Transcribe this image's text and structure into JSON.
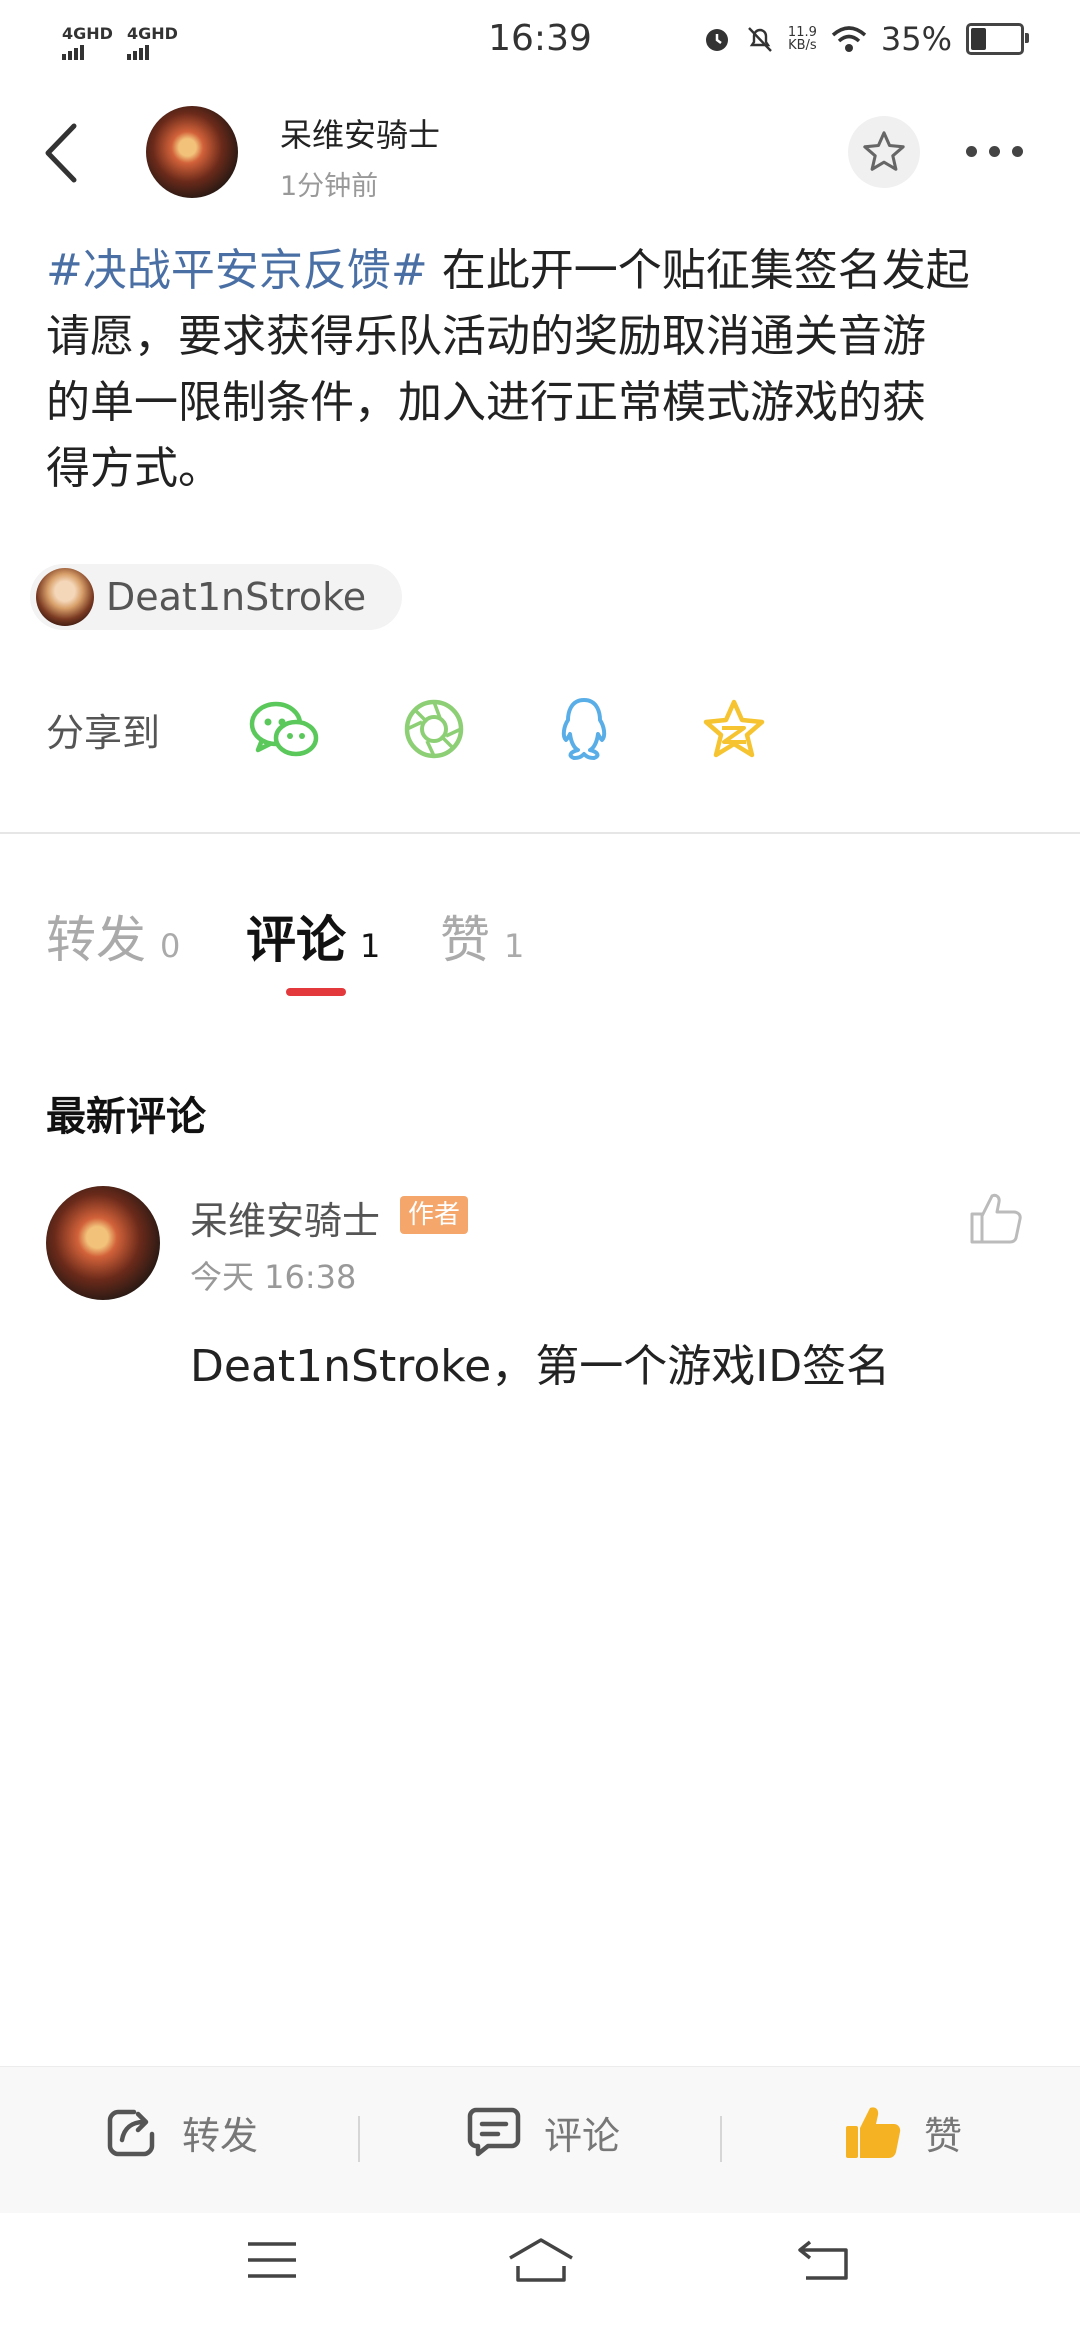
{
  "status_bar": {
    "network_1": "4GHD",
    "network_2": "4GHD",
    "time": "16:39",
    "speed_value": "11.9",
    "speed_unit": "KB/s",
    "battery_percent": "35%",
    "battery_level": 0.35
  },
  "header": {
    "author_name": "呆维安骑士",
    "post_time": "1分钟前"
  },
  "post": {
    "hashtag": "#决战平安京反馈#",
    "text_line1": " 在此开一个贴征集签名发起",
    "text_line2": "请愿，要求获得乐队活动的奖励取消通关音游",
    "text_line3": "的单一限制条件，加入进行正常模式游戏的获",
    "text_line4": "得方式。"
  },
  "mention": {
    "name": "Deat1nStroke"
  },
  "share": {
    "label": "分享到",
    "targets": [
      "wechat-icon",
      "moments-icon",
      "qq-icon",
      "qzone-icon"
    ]
  },
  "tabs": [
    {
      "label": "转发",
      "count": "0"
    },
    {
      "label": "评论",
      "count": "1",
      "active": true
    },
    {
      "label": "赞",
      "count": "1"
    }
  ],
  "comments_section": {
    "title": "最新评论",
    "items": [
      {
        "author": "呆维安骑士",
        "badge": "作者",
        "time": "今天 16:38",
        "text": "Deat1nStroke，第一个游戏ID签名"
      }
    ]
  },
  "bottom_actions": {
    "repost": "转发",
    "comment": "评论",
    "like": "赞"
  },
  "colors": {
    "accent_red": "#e4393c",
    "hashtag_blue": "#4a6fa5",
    "author_badge": "#f5a66b",
    "like_yellow": "#f5b324",
    "wechat_green": "#5ac85a",
    "qq_blue": "#5aaee8"
  }
}
